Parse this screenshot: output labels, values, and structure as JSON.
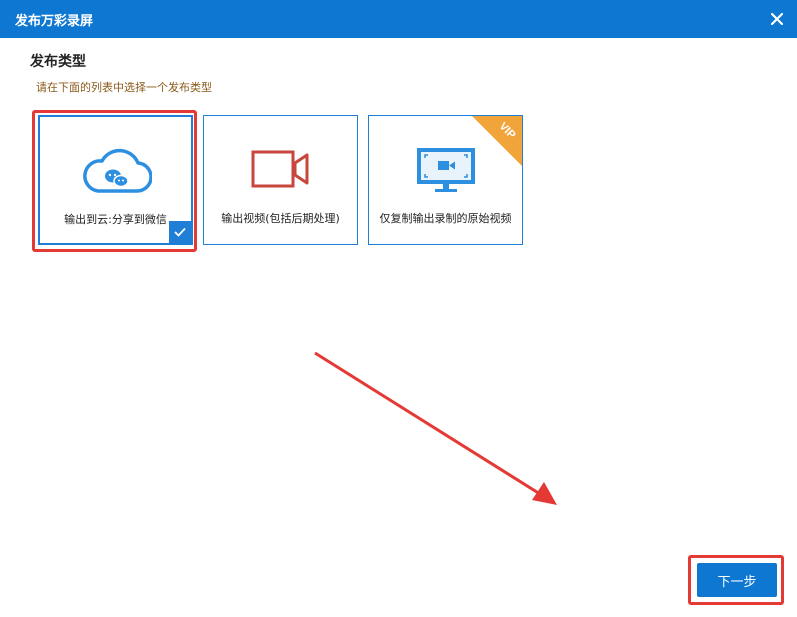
{
  "dialog": {
    "title": "发布万彩录屏",
    "close_icon": "close-icon"
  },
  "section": {
    "title": "发布类型",
    "hint": "请在下面的列表中选择一个发布类型"
  },
  "options": [
    {
      "label": "输出到云:分享到微信",
      "icon": "cloud-wechat-icon",
      "selected": true
    },
    {
      "label": "输出视频(包括后期处理)",
      "icon": "video-camera-icon",
      "selected": false
    },
    {
      "label": "仅复制输出录制的原始视频",
      "icon": "monitor-video-icon",
      "selected": false,
      "badge": "VIP"
    }
  ],
  "footer": {
    "next_label": "下一步"
  },
  "colors": {
    "titlebar": "#0d77d1",
    "accent": "#1f7ed6",
    "highlight": "#e53935",
    "vip": "#f0a43a"
  }
}
